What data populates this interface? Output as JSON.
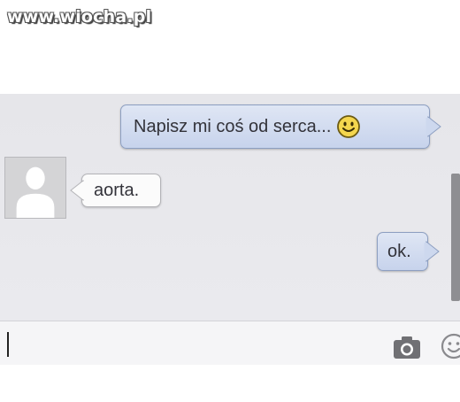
{
  "watermark": "www.wiocha.pl",
  "messages": [
    {
      "text": "Napisz mi coś od serca...",
      "direction": "outgoing",
      "emoji": "smiley-icon"
    },
    {
      "text": "aorta.",
      "direction": "incoming"
    },
    {
      "text": "ok.",
      "direction": "outgoing"
    }
  ],
  "input": {
    "value": ""
  },
  "colors": {
    "outgoing_bubble": "#c7d3ec",
    "incoming_bubble": "#fbfbfb",
    "chat_background": "#e6e6ea"
  }
}
